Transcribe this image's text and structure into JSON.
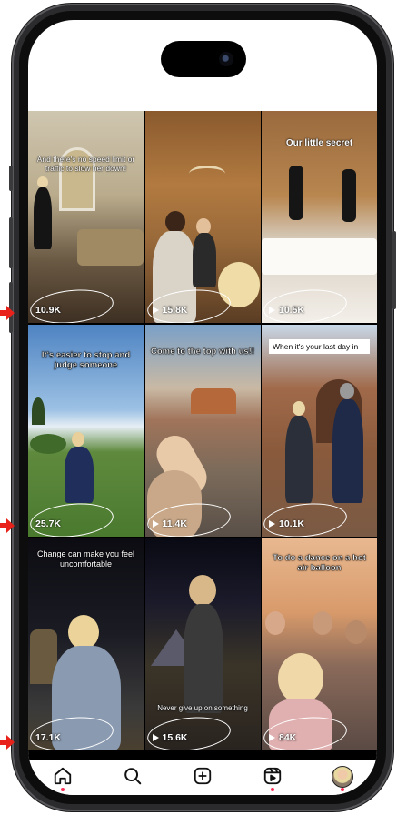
{
  "grid": {
    "tiles": [
      {
        "caption": "And there's no speed limit or traffic to slow her down!",
        "views": "10.9K",
        "play_icon": false
      },
      {
        "caption": "",
        "views": "15.8K",
        "play_icon": true
      },
      {
        "caption": "Our little secret",
        "views": "10.5K",
        "play_icon": true
      },
      {
        "caption": "It's easier to stop and judge someone",
        "views": "25.7K",
        "play_icon": false
      },
      {
        "caption": "Come to the top with us!!",
        "views": "11.4K",
        "play_icon": true
      },
      {
        "caption": "When it's your last day in",
        "views": "10.1K",
        "play_icon": true
      },
      {
        "caption": "Change can make you feel uncomfortable",
        "views": "17.1K",
        "play_icon": false
      },
      {
        "caption": "Never give up on something",
        "views": "15.6K",
        "play_icon": true
      },
      {
        "caption": "To do a dance on a hot air balloon",
        "views": "84K",
        "play_icon": true
      }
    ]
  },
  "tabbar": {
    "items": [
      "home-icon",
      "search-icon",
      "create-icon",
      "reels-icon",
      "profile-avatar"
    ]
  },
  "colors": {
    "annotation_arrow": "#e8211a",
    "notification_dot": "#ff2d55"
  }
}
